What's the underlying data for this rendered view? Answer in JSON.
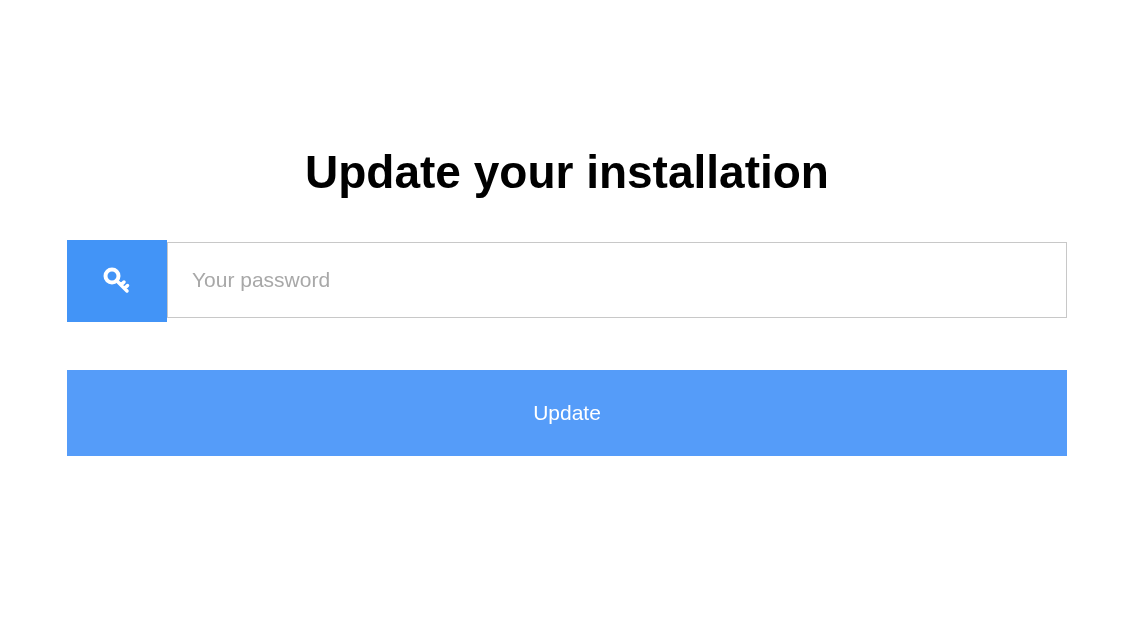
{
  "title": "Update your installation",
  "password_field": {
    "placeholder": "Your password"
  },
  "submit_button": {
    "label": "Update"
  }
}
